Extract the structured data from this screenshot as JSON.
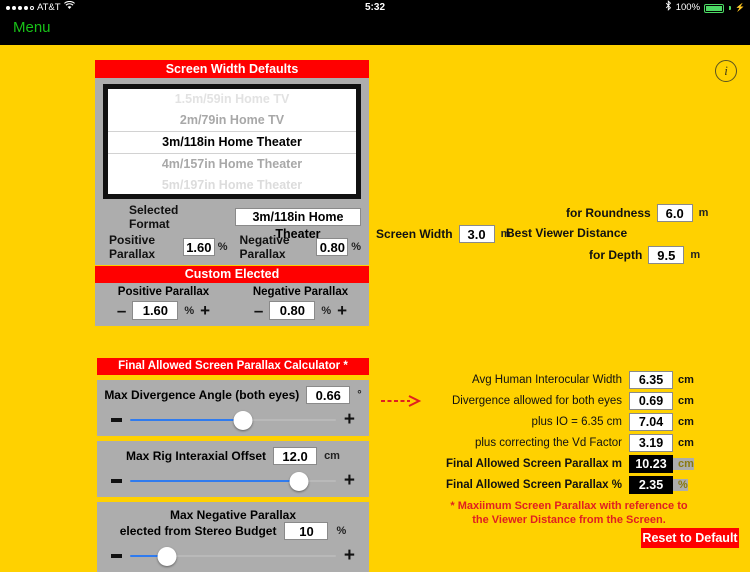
{
  "status_bar": {
    "carrier": "AT&T",
    "signal_dots_filled": 4,
    "signal_dots_total": 5,
    "wifi_icon": "wifi-icon",
    "time": "5:32",
    "bluetooth_icon": "bluetooth-icon",
    "battery_percent": "100%",
    "battery_icon": "battery-full-charging-icon"
  },
  "nav": {
    "menu_label": "Menu",
    "info_icon": "info-icon",
    "info_glyph": "i"
  },
  "screen_width_defaults": {
    "title": "Screen Width Defaults",
    "picker_options": [
      "1.5m/59in Home TV",
      "2m/79in Home TV",
      "3m/118in Home Theater",
      "4m/157in Home Theater",
      "5m/197in Home Theater"
    ],
    "selected_index": 2,
    "selected_format_label": "Selected Format",
    "selected_format_value": "3m/118in Home Theater",
    "positive_parallax_label": "Positive Parallax",
    "positive_parallax_value": "1.60",
    "positive_parallax_unit": "%",
    "negative_parallax_label": "Negative Parallax",
    "negative_parallax_value": "0.80",
    "negative_parallax_unit": "%"
  },
  "custom_elected": {
    "title": "Custom Elected",
    "positive_label": "Positive Parallax",
    "negative_label": "Negative Parallax",
    "positive_value": "1.60",
    "positive_unit": "%",
    "negative_value": "0.80",
    "negative_unit": "%",
    "minus_glyph": "–",
    "plus_glyph": "+"
  },
  "screen_metrics": {
    "screen_width_label": "Screen Width",
    "screen_width_value": "3.0",
    "screen_width_unit": "m",
    "best_viewer_distance_label": "Best Viewer Distance",
    "for_roundness_label": "for Roundness",
    "for_roundness_value": "6.0",
    "for_roundness_unit": "m",
    "for_depth_label": "for Depth",
    "for_depth_value": "9.5",
    "for_depth_unit": "m"
  },
  "calculator": {
    "title": "Final Allowed Screen Parallax Calculator *",
    "sliders": [
      {
        "label": "Max Divergence Angle (both eyes)",
        "value": "0.66",
        "unit": "°",
        "fill_percent": 55
      },
      {
        "label": "Max Rig Interaxial Offset",
        "value": "12.0",
        "unit": "cm",
        "fill_percent": 82
      },
      {
        "label_line1": "Max Negative Parallax",
        "label_line2": "elected from  Stereo Budget",
        "value": "10",
        "unit": "%",
        "fill_percent": 18
      }
    ]
  },
  "results": {
    "rows": [
      {
        "label": "Avg Human Interocular Width",
        "value": "6.35",
        "unit": "cm",
        "bold": false,
        "dark": false,
        "arrow": false
      },
      {
        "label": "Divergence allowed for both eyes",
        "value": "0.69",
        "unit": "cm",
        "bold": false,
        "dark": false,
        "arrow": true
      },
      {
        "label": "plus IO = 6.35  cm",
        "value": "7.04",
        "unit": "cm",
        "bold": false,
        "dark": false,
        "arrow": false
      },
      {
        "label": "plus correcting the Vd Factor",
        "value": "3.19",
        "unit": "cm",
        "bold": false,
        "dark": false,
        "arrow": false
      },
      {
        "label": "Final Allowed Screen Parallax m",
        "value": "10.23",
        "unit": "cm",
        "bold": true,
        "dark": true,
        "arrow": false
      },
      {
        "label": "Final Allowed  Screen Parallax %",
        "value": "2.35",
        "unit": "%",
        "bold": true,
        "dark": true,
        "arrow": false
      }
    ],
    "footnote_line1": "* Maxiimum Screen Parallax with reference to",
    "footnote_line2": "the Viewer Distance from the Screen.",
    "reset_label": "Reset to Default"
  },
  "colors": {
    "background_yellow": "#FFD100",
    "panel_gray": "#ADADAD",
    "accent_red": "#FF0000",
    "menu_green": "#18C018",
    "slider_blue": "#2F7BEF",
    "battery_green": "#4CD964"
  }
}
